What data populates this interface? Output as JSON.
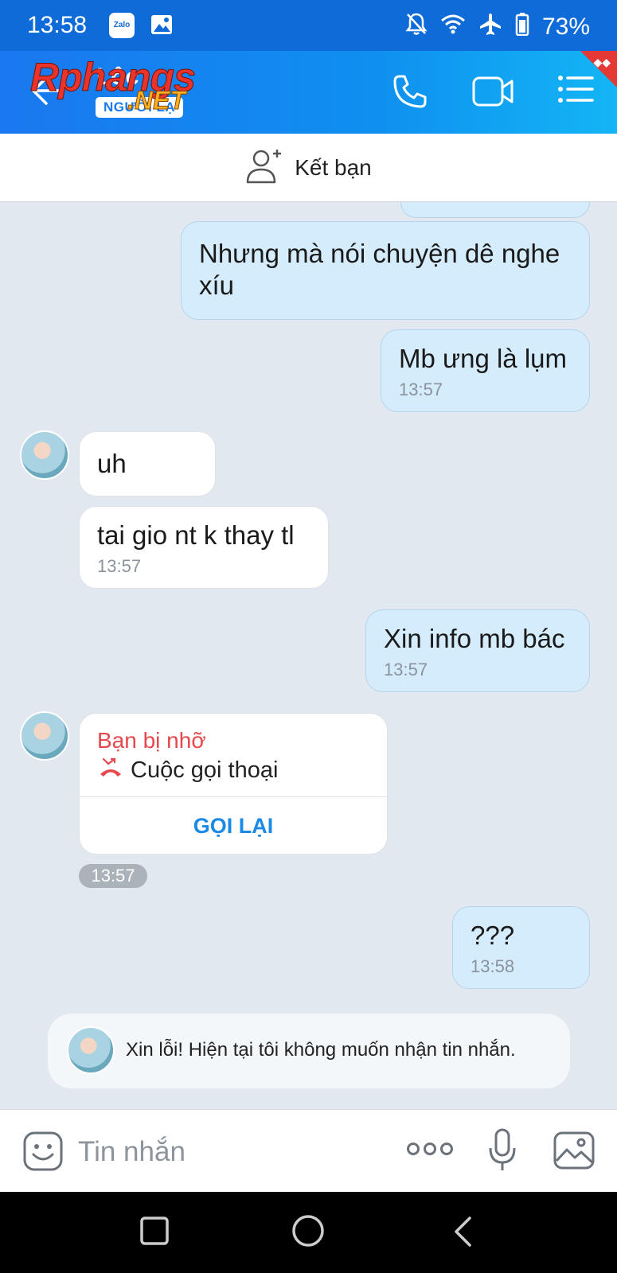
{
  "status_bar": {
    "time": "13:58",
    "battery": "73%",
    "icons": [
      "zalo-icon",
      "gallery-icon",
      "mute-icon",
      "wifi-icon",
      "airplane-icon",
      "battery-icon"
    ],
    "zalo_label": "Zalo"
  },
  "header": {
    "contact_name": "Lộc",
    "stranger_badge": "NGƯỜI LẠ",
    "watermark_main": "Rphangs",
    "watermark_net": ".NET",
    "icons": [
      "back-arrow-icon",
      "phone-icon",
      "video-icon",
      "menu-icon"
    ],
    "accent_color": "#1a78f0"
  },
  "add_friend": {
    "label": "Kết bạn",
    "icon": "add-person-icon"
  },
  "messages": [
    {
      "direction": "out",
      "text": "Nhưng mà nói chuyện dê nghe xíu"
    },
    {
      "direction": "out",
      "text": "Mb ưng là lụm",
      "time": "13:57"
    },
    {
      "direction": "in",
      "text": "uh"
    },
    {
      "direction": "in",
      "text": "tai gio nt k thay tl",
      "time": "13:57"
    },
    {
      "direction": "out",
      "text": "Xin info mb bác",
      "time": "13:57"
    },
    {
      "direction": "out",
      "text": "???",
      "time": "13:58"
    }
  ],
  "missed_call": {
    "title": "Bạn bị nhỡ",
    "call_type": "Cuộc gọi thoại",
    "action": "GỌI LẠI",
    "time": "13:57",
    "icon": "missed-call-icon",
    "title_color": "#e5484d"
  },
  "notice": {
    "text": "Xin lỗi! Hiện tại tôi không muốn nhận tin nhắn."
  },
  "input": {
    "placeholder": "Tin nhắn",
    "icons": [
      "emoji-icon",
      "more-icon",
      "mic-icon",
      "image-icon"
    ]
  },
  "nav": {
    "icons": [
      "recents-icon",
      "home-icon",
      "back-icon"
    ]
  }
}
